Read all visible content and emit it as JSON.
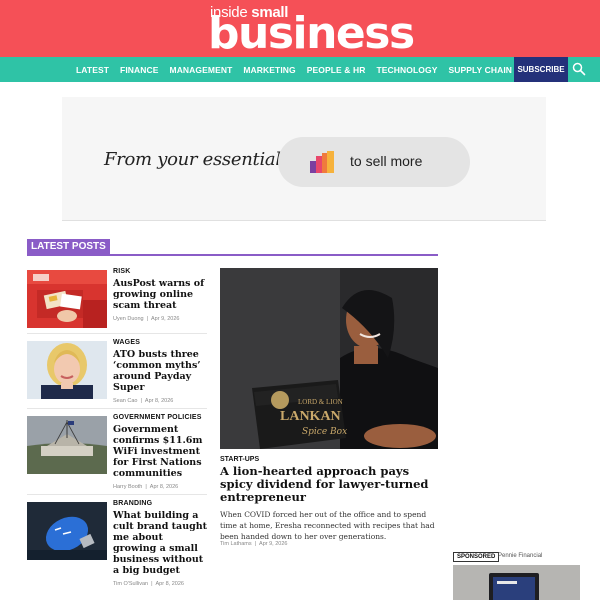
{
  "header": {
    "logo_small_prefix": "inside",
    "logo_small_bold": "small",
    "logo_big": "business",
    "bg_color": "#f55057"
  },
  "nav": {
    "items": [
      "LATEST",
      "FINANCE",
      "MANAGEMENT",
      "MARKETING",
      "PEOPLE & HR",
      "TECHNOLOGY",
      "SUPPLY CHAIN"
    ],
    "subscribe": "SUBSCRIBE",
    "search_icon": "search-icon",
    "bg_color": "#2fc3a6",
    "subscribe_color": "#24317a"
  },
  "ad": {
    "tagline": "From your essentials",
    "pill_text": "to sell more",
    "icon": "bar-chart-icon"
  },
  "latest": {
    "title": "LATEST POSTS",
    "accent": "#8a5cc7",
    "posts": [
      {
        "category": "RISK",
        "headline": "AusPost warns of growing online scam threat",
        "author": "Uyen Duong",
        "date": "Apr 9, 2026"
      },
      {
        "category": "WAGES",
        "headline": "ATO busts three ‘common myths’ around Payday Super",
        "author": "Sean Cao",
        "date": "Apr 8, 2026"
      },
      {
        "category": "GOVERNMENT POLICIES",
        "headline": "Government confirms $11.6m WiFi investment for First Nations communities",
        "author": "Harry Booth",
        "date": "Apr 8, 2026"
      },
      {
        "category": "BRANDING",
        "headline": "What building a cult brand taught me about growing a small business without a big budget",
        "author": "Tim O'Sullivan",
        "date": "Apr 8, 2026"
      }
    ]
  },
  "feature": {
    "category": "START-UPS",
    "headline": "A lion-hearted approach pays spicy dividend for lawyer-turned entrepreneur",
    "summary": "When COVID forced her out of the office and to spend time at home, Eresha reconnected with recipes that had been handed down to her over generations.",
    "author": "Tim Lathams",
    "date": "Apr 9, 2026",
    "box_line1": "LORD & LION",
    "box_line2": "LANKAN",
    "box_line3": "Spice Box"
  },
  "sponsored": {
    "tag": "SPONSORED",
    "name": "Pennie Financial"
  }
}
